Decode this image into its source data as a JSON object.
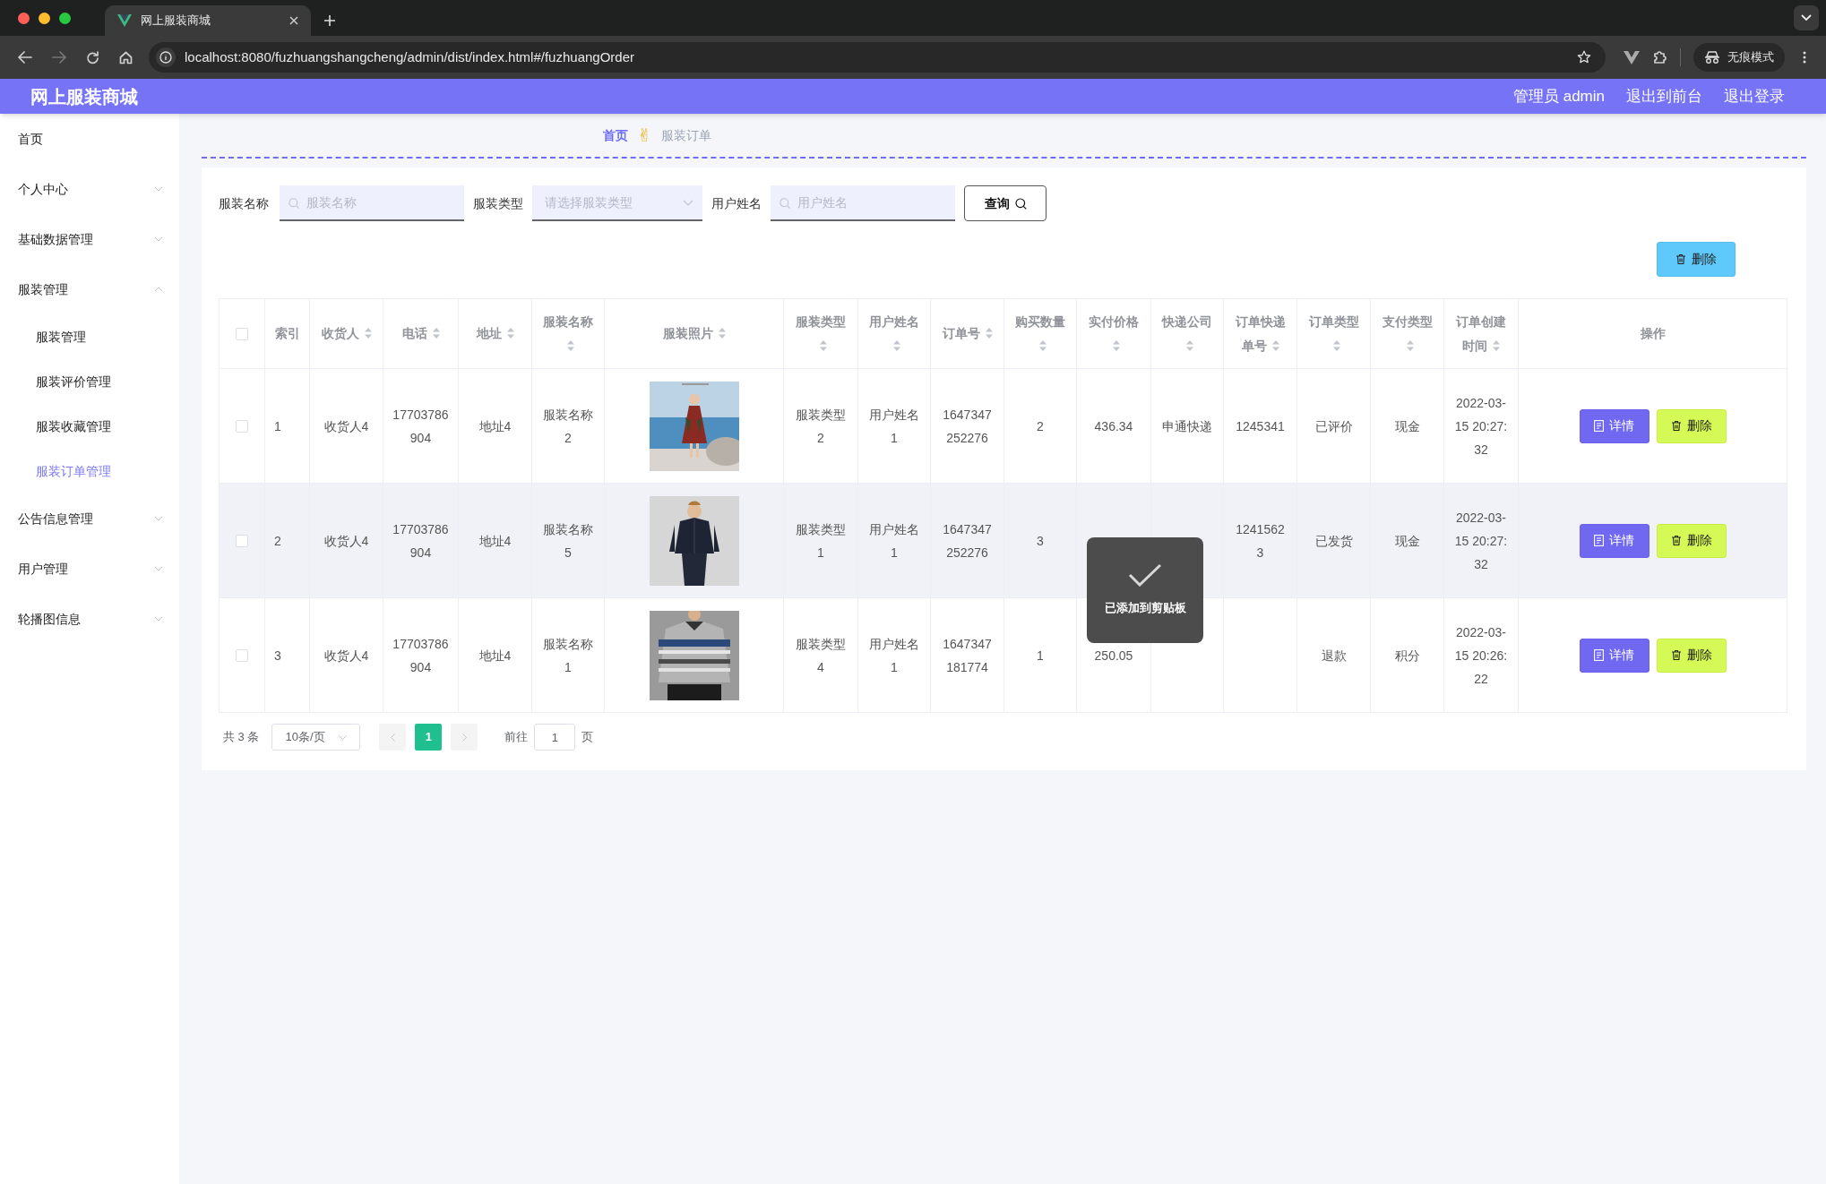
{
  "browser": {
    "tab_title": "网上服装商城",
    "url": "localhost:8080/fuzhuangshangcheng/admin/dist/index.html#/fuzhuangOrder",
    "mode_label": "无痕模式"
  },
  "header": {
    "title": "网上服装商城",
    "links": [
      "管理员 admin",
      "退出到前台",
      "退出登录"
    ]
  },
  "sidebar": {
    "items": [
      {
        "label": "首页",
        "kind": "link"
      },
      {
        "label": "个人中心",
        "kind": "group",
        "expanded": false
      },
      {
        "label": "基础数据管理",
        "kind": "group",
        "expanded": false
      },
      {
        "label": "服装管理",
        "kind": "group",
        "expanded": true,
        "children": [
          {
            "label": "服装管理",
            "selected": false
          },
          {
            "label": "服装评价管理",
            "selected": false
          },
          {
            "label": "服装收藏管理",
            "selected": false
          },
          {
            "label": "服装订单管理",
            "selected": true
          }
        ]
      },
      {
        "label": "公告信息管理",
        "kind": "group",
        "expanded": false
      },
      {
        "label": "用户管理",
        "kind": "group",
        "expanded": false
      },
      {
        "label": "轮播图信息",
        "kind": "group",
        "expanded": false
      }
    ]
  },
  "breadcrumb": {
    "items": [
      {
        "label": "首页",
        "kind": "link"
      },
      {
        "label": "服装订单",
        "kind": "current"
      }
    ],
    "separator": "✌"
  },
  "filters": [
    {
      "label": "服装名称",
      "kind": "search",
      "placeholder": "服装名称"
    },
    {
      "label": "服装类型",
      "kind": "select",
      "placeholder": "请选择服装类型"
    },
    {
      "label": "用户姓名",
      "kind": "search",
      "placeholder": "用户姓名"
    }
  ],
  "query_button": "查询",
  "delete_button": "删除",
  "table": {
    "select_all_checked": false,
    "columns": [
      {
        "label": "索引",
        "kind": "text",
        "sortable": false
      },
      {
        "label": "收货人",
        "kind": "text",
        "sortable": true
      },
      {
        "label": "电话",
        "kind": "text",
        "sortable": true
      },
      {
        "label": "地址",
        "kind": "text",
        "sortable": true
      },
      {
        "label": "服装名称",
        "kind": "text",
        "sortable": true
      },
      {
        "label": "服装照片",
        "sortable": true
      },
      {
        "label": "服装类型",
        "kind": "text",
        "sortable": true
      },
      {
        "label": "用户姓名",
        "kind": "text",
        "sortable": true
      },
      {
        "label": "订单号",
        "kind": "text",
        "sortable": true
      },
      {
        "label": "购买数量",
        "kind": "text",
        "sortable": true
      },
      {
        "label": "实付价格",
        "kind": "text",
        "sortable": true
      },
      {
        "label": "快递公司",
        "kind": "text",
        "sortable": true
      },
      {
        "label": "订单快递单号",
        "kind": "text",
        "sortable": true
      },
      {
        "label": "订单类型",
        "kind": "text",
        "sortable": true
      },
      {
        "label": "支付类型",
        "kind": "text",
        "sortable": true
      },
      {
        "label": "订单创建时间",
        "kind": "text",
        "sortable": true
      },
      {
        "label": "操作",
        "kind": "actions",
        "sortable": false
      }
    ],
    "rows": [
      {
        "checked": false,
        "highlighted": false,
        "cells": [
          "1",
          "收货人4",
          "17703786904",
          "地址4",
          "服装名称2",
          {
            "kind": "picture"
          },
          "服装类型2",
          "用户姓名1",
          "1647347252276",
          "2",
          "436.34",
          "申通快递",
          "1245341",
          "已评价",
          "现金",
          "2022-03-15 20:27:32"
        ],
        "actions": [
          {
            "label": "详情",
            "kind": "detail"
          },
          {
            "label": "删除",
            "kind": "delete"
          }
        ]
      },
      {
        "checked": false,
        "highlighted": true,
        "cells": [
          "2",
          "收货人4",
          "17703786904",
          "地址4",
          "服装名称5",
          {
            "kind": "picture"
          },
          "服装类型1",
          "用户姓名1",
          "1647347252276",
          "3",
          null,
          null,
          "12415623",
          "已发货",
          "现金",
          "2022-03-15 20:27:32"
        ],
        "actions": [
          {
            "label": "详情",
            "kind": "detail"
          },
          {
            "label": "删除",
            "kind": "delete"
          }
        ]
      },
      {
        "checked": false,
        "highlighted": false,
        "cells": [
          "3",
          "收货人4",
          "17703786904",
          "地址4",
          "服装名称1",
          {
            "kind": "picture"
          },
          "服装类型4",
          "用户姓名1",
          "1647347181774",
          "1",
          "250.05",
          null,
          null,
          "退款",
          "积分",
          "2022-03-15 20:26:22"
        ],
        "actions": [
          {
            "label": "详情",
            "kind": "detail"
          },
          {
            "label": "删除",
            "kind": "delete"
          }
        ]
      }
    ]
  },
  "pagination": {
    "total": "共 3 条",
    "page_size": "10条/页",
    "pages": [
      {
        "label": "1",
        "selected": true
      }
    ],
    "goto_label": "前往",
    "goto_value": "1",
    "goto_suffix": "页"
  },
  "toast": {
    "message": "已添加到剪贴板"
  }
}
